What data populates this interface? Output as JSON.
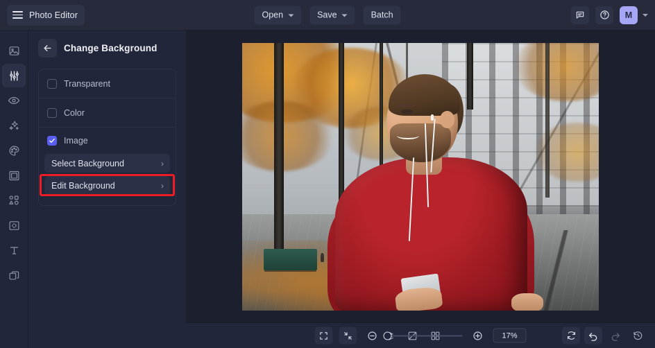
{
  "app": {
    "title": "Photo Editor",
    "menu_icon": "hamburger-icon"
  },
  "topbar": {
    "open_label": "Open",
    "save_label": "Save",
    "batch_label": "Batch",
    "feedback_icon": "comment-icon",
    "help_icon": "question-circle-icon",
    "avatar_initial": "M",
    "avatar_color": "#a5a6f6"
  },
  "rail": {
    "items": [
      {
        "name": "image-icon",
        "label": "Image",
        "active": false
      },
      {
        "name": "adjust-icon",
        "label": "Adjust",
        "active": true
      },
      {
        "name": "eye-icon",
        "label": "Retouch",
        "active": false
      },
      {
        "name": "sparkles-icon",
        "label": "Effects",
        "active": false
      },
      {
        "name": "palette-icon",
        "label": "Color",
        "active": false
      },
      {
        "name": "frame-icon",
        "label": "Frame",
        "active": false
      },
      {
        "name": "shapes-icon",
        "label": "Shapes",
        "active": false
      },
      {
        "name": "focus-icon",
        "label": "Crop",
        "active": false
      },
      {
        "name": "text-icon",
        "label": "Text",
        "active": false
      },
      {
        "name": "layers-icon",
        "label": "Layers",
        "active": false
      }
    ]
  },
  "panel": {
    "back_icon": "arrow-left-icon",
    "title": "Change Background",
    "options": [
      {
        "label": "Transparent",
        "checked": false
      },
      {
        "label": "Color",
        "checked": false
      },
      {
        "label": "Image",
        "checked": true
      }
    ],
    "sub_buttons": [
      {
        "label": "Select Background",
        "chevron": "›",
        "highlighted": false
      },
      {
        "label": "Edit Background",
        "chevron": "›",
        "highlighted": true
      }
    ],
    "highlight_color": "#ee1c24"
  },
  "canvas": {
    "image_alt": "Smiling bearded man in red sweater with earphones holding a phone on an autumn city street"
  },
  "bottombar": {
    "left_tools": [
      {
        "name": "layers-stack-icon",
        "label": "Layers"
      },
      {
        "name": "compare-icon",
        "label": "Compare"
      },
      {
        "name": "grid-icon",
        "label": "Grid"
      }
    ],
    "view_tools": [
      {
        "name": "fit-screen-icon",
        "label": "Fit to screen"
      },
      {
        "name": "collapse-icon",
        "label": "Actual size"
      }
    ],
    "zoom_out_icon": "minus-circle-icon",
    "zoom_in_icon": "plus-circle-icon",
    "zoom_value": "17%",
    "slider_position_pct": 0,
    "history_tools": [
      {
        "name": "reset-icon",
        "label": "Reset",
        "dim": false
      },
      {
        "name": "undo-icon",
        "label": "Undo",
        "dim": false
      },
      {
        "name": "redo-icon",
        "label": "Redo",
        "dim": true
      },
      {
        "name": "history-icon",
        "label": "History",
        "dim": false
      }
    ]
  }
}
